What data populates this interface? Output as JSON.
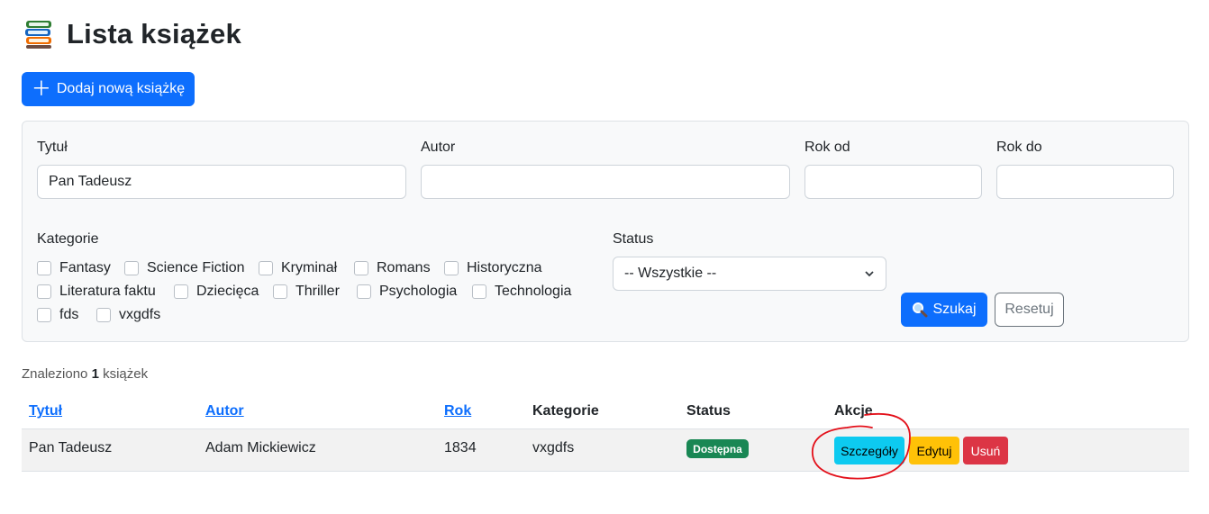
{
  "header": {
    "title": "Lista książek",
    "icon": "books-icon"
  },
  "actions": {
    "add_label": "Dodaj nową książkę"
  },
  "filters": {
    "title_label": "Tytuł",
    "title_value": "Pan Tadeusz",
    "author_label": "Autor",
    "author_value": "",
    "year_from_label": "Rok od",
    "year_to_label": "Rok do",
    "categories_label": "Kategorie",
    "categories": [
      "Fantasy",
      "Science Fiction",
      "Kryminał",
      "Romans",
      "Historyczna",
      "Literatura faktu",
      "Dziecięca",
      "Thriller",
      "Psychologia",
      "Technologia",
      "fds",
      "vxgdfs"
    ],
    "status_label": "Status",
    "status_selected": "-- Wszystkie --",
    "search_label": "Szukaj",
    "reset_label": "Resetuj"
  },
  "results": {
    "found_prefix": "Znaleziono",
    "count": "1",
    "found_suffix": "książek"
  },
  "table": {
    "headers": [
      "Tytuł",
      "Autor",
      "Rok",
      "Kategorie",
      "Status",
      "Akcje"
    ],
    "rows": [
      {
        "title": "Pan Tadeusz",
        "author": "Adam Mickiewicz",
        "year": "1834",
        "category": "vxgdfs",
        "status": "Dostępna"
      }
    ],
    "row_actions": {
      "details": "Szczegóły",
      "edit": "Edytuj",
      "delete": "Usuń"
    }
  },
  "colors": {
    "primary": "#0d6efd",
    "success": "#198754",
    "info": "#0dcaf0",
    "warning": "#ffc107",
    "danger": "#dc3545",
    "annotation": "#e3101a"
  }
}
